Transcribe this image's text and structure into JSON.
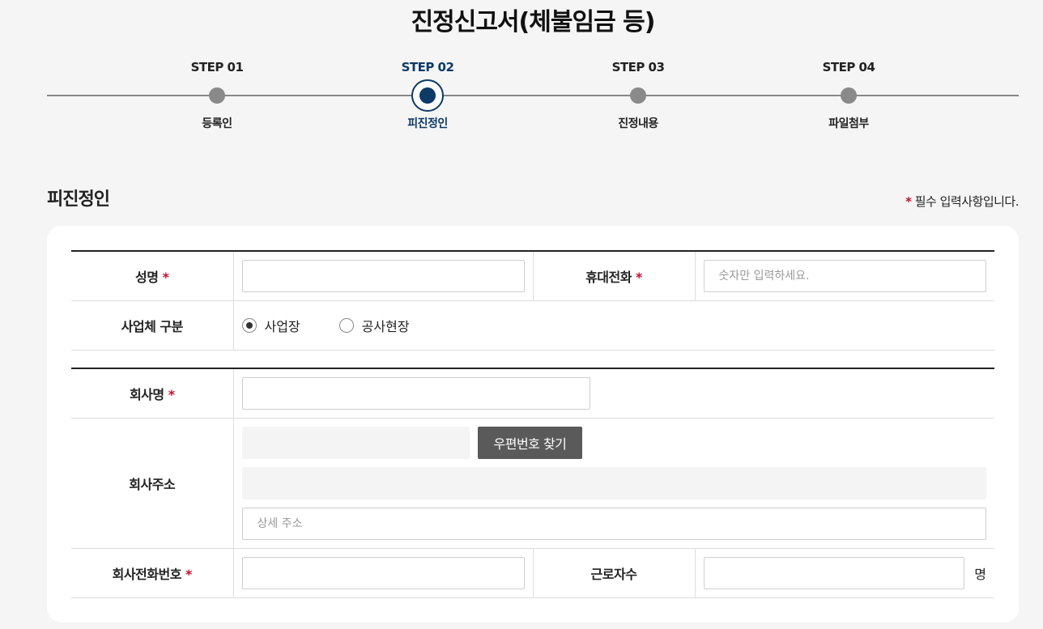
{
  "page": {
    "title": "진정신고서(체불임금 등)"
  },
  "stepper": {
    "steps": [
      {
        "label": "STEP 01",
        "name": "등록인",
        "active": false
      },
      {
        "label": "STEP 02",
        "name": "피진정인",
        "active": true
      },
      {
        "label": "STEP 03",
        "name": "진정내용",
        "active": false
      },
      {
        "label": "STEP 04",
        "name": "파일첨부",
        "active": false
      }
    ]
  },
  "section": {
    "title": "피진정인",
    "required_star": "*",
    "required_note": " 필수 입력사항입니다."
  },
  "form": {
    "required_mark": "*",
    "name_label": "성명",
    "name_value": "",
    "phone_label": "휴대전화",
    "phone_placeholder": "숫자만 입력하세요.",
    "biz_type_label": "사업체 구분",
    "biz_type_options": [
      "사업장",
      "공사현장"
    ],
    "biz_type_selected": "사업장",
    "company_label": "회사명",
    "company_value": "",
    "address_label": "회사주소",
    "zip_value": "",
    "zip_button": "우편번호 찾기",
    "address_value": "",
    "address_detail_placeholder": "상세 주소",
    "company_phone_label": "회사전화번호",
    "company_phone_value": "",
    "workers_label": "근로자수",
    "workers_value": "",
    "workers_unit": "명"
  },
  "colors": {
    "accent": "#0d3a66",
    "required": "#c8102e",
    "button": "#5a5a5a"
  }
}
